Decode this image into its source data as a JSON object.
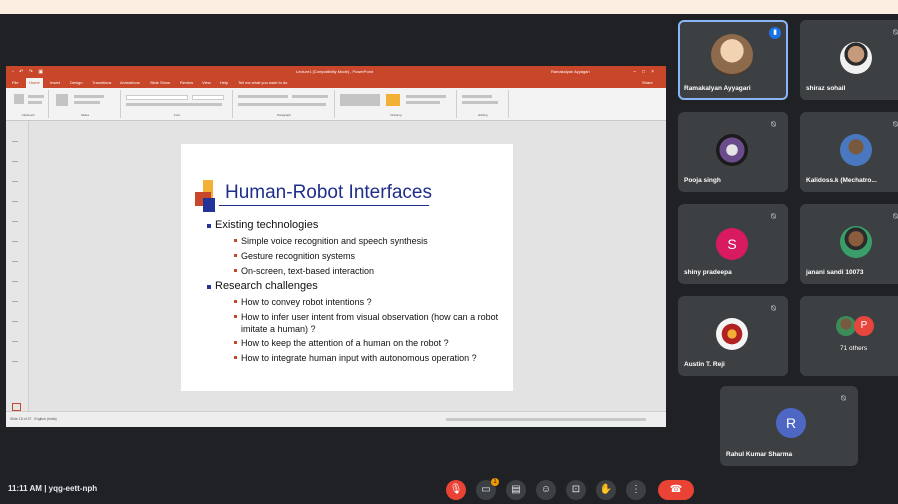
{
  "powerpoint": {
    "window_title": "Lecture1 [Compatibility Mode] - PowerPoint",
    "signed_in_user": "Ramakalyan Ayyagari",
    "tabs": [
      "File",
      "Home",
      "Insert",
      "Design",
      "Transitions",
      "Animations",
      "Slide Show",
      "Review",
      "View",
      "Help"
    ],
    "tell_me": "Tell me what you want to do",
    "share_label": "Share",
    "ribbon_groups": [
      "Clipboard",
      "Slides",
      "Font",
      "Paragraph",
      "Drawing",
      "Editing"
    ],
    "status_left": "Slide 15 of 37",
    "status_lang": "English (India)",
    "accent_color": "#c8462a"
  },
  "slide": {
    "title": "Human-Robot Interfaces",
    "sections": [
      {
        "heading": "Existing technologies",
        "items": [
          "Simple voice recognition and speech synthesis",
          "Gesture recognition systems",
          "On-screen, text-based interaction"
        ]
      },
      {
        "heading": "Research challenges",
        "items": [
          "How to convey robot intentions ?",
          "How to infer user intent from visual observation (how can a robot imitate a human) ?",
          "How to keep the attention of a human on the robot ?",
          "How to integrate human input with autonomous operation ?"
        ]
      }
    ]
  },
  "participants": [
    {
      "name": "Ramakalyan Ayyagari",
      "mic": "speaking",
      "avatar": "photo"
    },
    {
      "name": "shiraz sohail",
      "mic": "muted",
      "avatar": "photo"
    },
    {
      "name": "Pooja singh",
      "mic": "muted",
      "avatar": "photo"
    },
    {
      "name": "Kalidoss.k (Mechatro...",
      "mic": "muted",
      "avatar": "photo"
    },
    {
      "name": "shiny pradeepa",
      "mic": "muted",
      "avatar": "letter",
      "letter": "S",
      "color": "#d81b60"
    },
    {
      "name": "janani sandi 10073",
      "mic": "muted",
      "avatar": "photo"
    },
    {
      "name": "Austin T. Reji",
      "mic": "muted",
      "avatar": "photo"
    },
    {
      "name": "71 others",
      "mic": "",
      "avatar": "stack",
      "letter": "P",
      "color": "#e8453c"
    },
    {
      "name": "Rahul Kumar Sharma",
      "mic": "muted",
      "avatar": "letter",
      "letter": "R",
      "color": "#4f67c4"
    }
  ],
  "bottom_bar": {
    "time": "11:11 AM",
    "separator": "|",
    "meeting_code": "yqg-eett-nph",
    "badge_count": "1"
  }
}
